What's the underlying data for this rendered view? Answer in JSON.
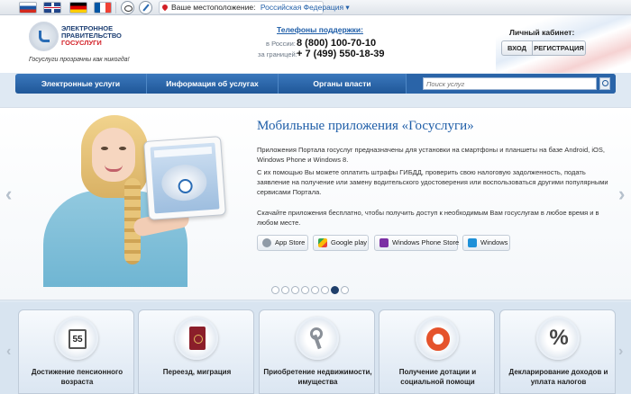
{
  "topbar": {
    "flags": [
      "ru-flag",
      "en-flag",
      "de-flag",
      "fr-flag"
    ],
    "location_label": "Ваше местоположение:",
    "location_value": "Российская Федерация"
  },
  "header": {
    "logo_line1": "ЭЛЕКТРОННОЕ",
    "logo_line2": "ПРАВИТЕЛЬСТВО",
    "logo_line3": "ГОСУСЛУГИ",
    "slogan": "Госуслуги прозрачны как никогда!",
    "phones_title": "Телефоны поддержки:",
    "phone_ru_label": "в России:",
    "phone_ru": "8 (800) 100-70-10",
    "phone_abroad_label": "за границей:",
    "phone_abroad": "+ 7 (499) 550-18-39",
    "cabinet_title": "Личный кабинет:",
    "login": "ВХОД",
    "register": "РЕГИСТРАЦИЯ"
  },
  "nav": {
    "items": [
      "Электронные услуги",
      "Информация об услугах",
      "Органы власти"
    ],
    "search_placeholder": "Поиск услуг"
  },
  "banner": {
    "title": "Мобильные приложения «Госуслуги»",
    "text1": "Приложения Портала госуслуг предназначены для установки на смартфоны и планшеты на базе Android, iOS, Windows Phone и Windows 8.",
    "text2": "С их помощью Вы можете оплатить штрафы ГИБДД, проверить свою налоговую задолженность, подать заявление на получение или замену водительского удостоверения или воспользоваться другими популярными сервисами Портала.",
    "text3": "Скачайте приложения бесплатно, чтобы получить доступ к необходимым Вам госуслугам в любое время и в любом месте.",
    "stores": [
      "App Store",
      "Google play",
      "Windows Phone Store",
      "Windows"
    ],
    "dots_total": 8,
    "dots_active": 7
  },
  "services": {
    "calendar_number": "55",
    "items": [
      "Достижение пенсионного возраста",
      "Переезд, миграция",
      "Приобретение недвижимости, имущества",
      "Получение дотации и социальной помощи",
      "Декларирование доходов и уплата налогов"
    ]
  }
}
